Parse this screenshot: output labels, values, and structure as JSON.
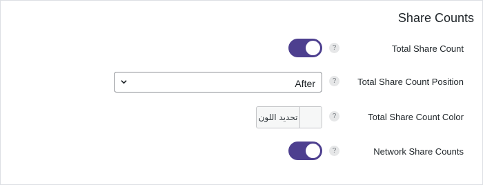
{
  "section": {
    "title": "Share Counts"
  },
  "settings": {
    "total_share_count": {
      "label": "Total Share Count",
      "enabled": true
    },
    "total_share_count_position": {
      "label": "Total Share Count Position",
      "selected": "After"
    },
    "total_share_count_color": {
      "label": "Total Share Count Color",
      "button_text": "تحديد اللون"
    },
    "network_share_counts": {
      "label": "Network Share Counts",
      "enabled": true
    }
  },
  "help": {
    "symbol": "?"
  },
  "colors": {
    "accent": "#4d3f8f",
    "border": "#dcdfe3",
    "help_bg": "#e6e7e8"
  }
}
